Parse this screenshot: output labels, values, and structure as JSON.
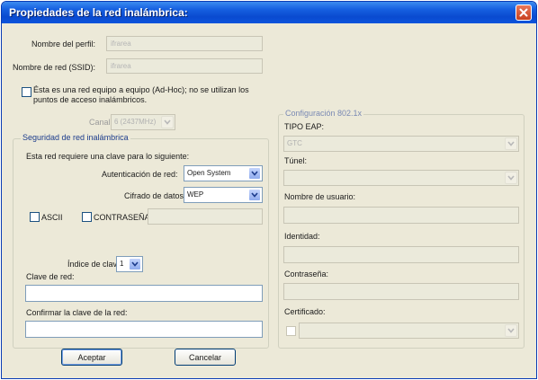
{
  "window": {
    "title": "Propiedades de la red inalámbrica:"
  },
  "profile": {
    "profile_name_label": "Nombre del perfil:",
    "profile_name_value": "ifrarea",
    "ssid_label": "Nombre de red (SSID):",
    "ssid_value": "ifrarea",
    "adhoc_label_line1": "Ésta es una red equipo a equipo (Ad-Hoc); no se utilizan los",
    "adhoc_label_line2": "puntos de acceso inalámbricos.",
    "channel_label": "Canal:",
    "channel_value": "6 (2437MHz)"
  },
  "security": {
    "group_title": "Seguridad de red inalámbrica",
    "requires_key_text": "Esta red requiere una clave para lo siguiente:",
    "auth_label": "Autenticación de red:",
    "auth_value": "Open System",
    "encryption_label": "Cifrado de datos:",
    "encryption_value": "WEP",
    "ascii_label": "ASCII",
    "password_label": "CONTRASEÑA",
    "key_index_label": "Índice de clave",
    "key_index_value": "1",
    "network_key_label": "Clave de red:",
    "confirm_key_label": "Confirmar la clave de la red:"
  },
  "config8021x": {
    "group_title": "Configuración 802.1x",
    "eap_type_label": "TIPO EAP:",
    "eap_type_value": "GTC",
    "tunnel_label": "Túnel:",
    "username_label": "Nombre de usuario:",
    "identity_label": "Identidad:",
    "password_label": "Contraseña:",
    "certificate_label": "Certificado:"
  },
  "buttons": {
    "accept_label": "Aceptar",
    "cancel_label": "Cancelar"
  },
  "colors": {
    "title_bar": "#0c54dc",
    "window_bg": "#ece9d8",
    "close_button": "#d45a36"
  },
  "icons": {
    "close": "close-icon",
    "dropdown": "chevron-down-icon"
  }
}
